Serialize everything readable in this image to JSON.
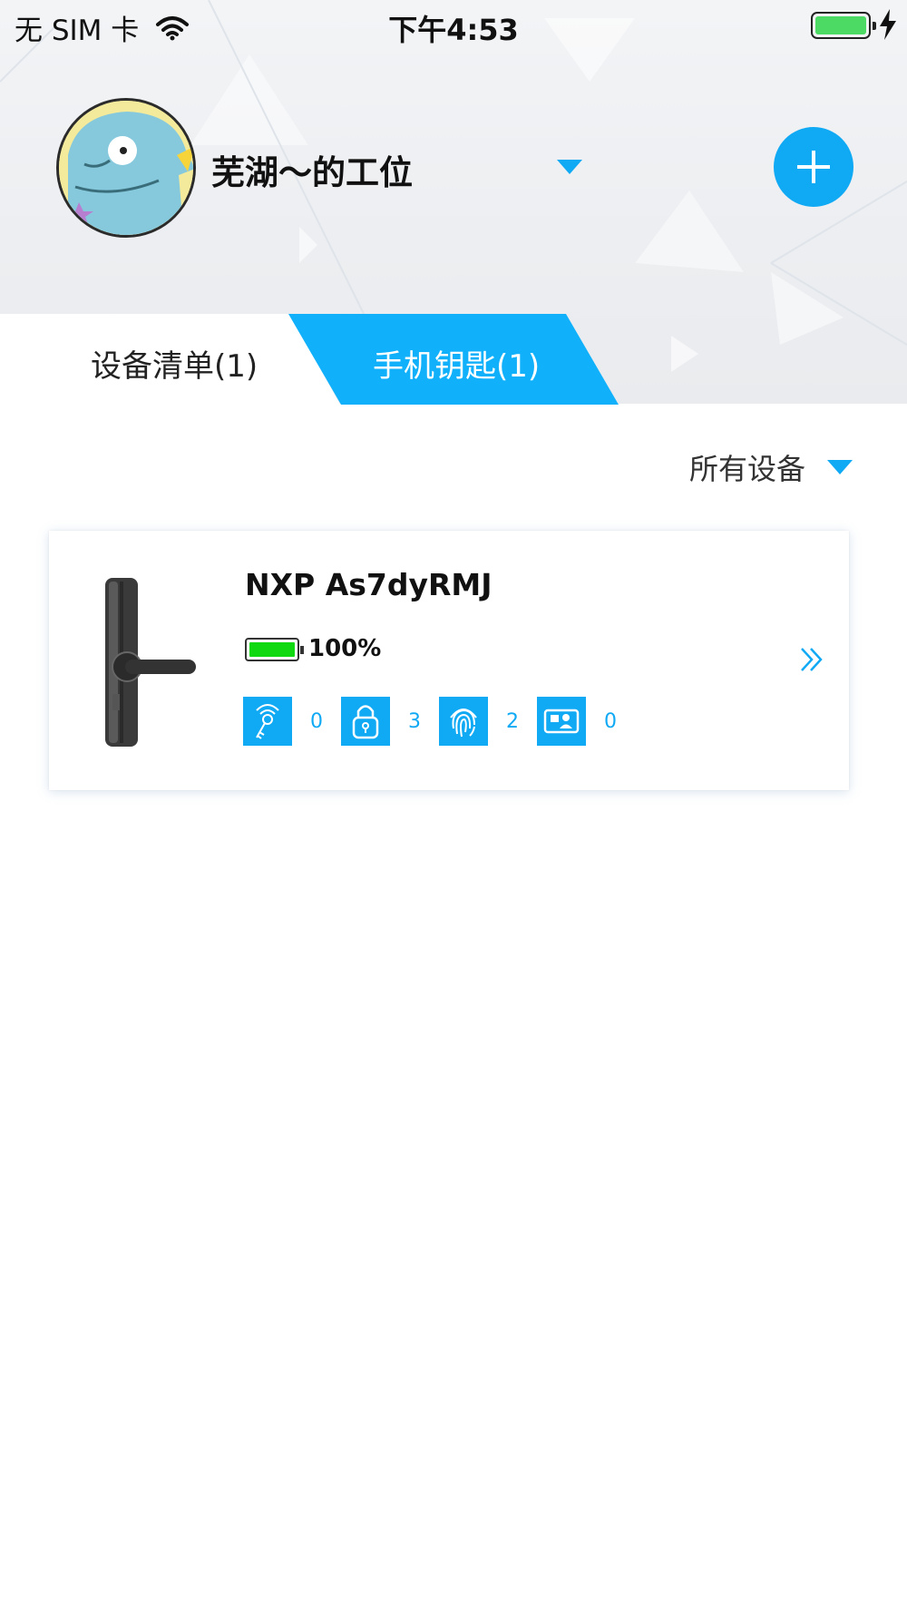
{
  "status_bar": {
    "carrier": "无 SIM 卡",
    "time": "下午4:53",
    "icons": [
      "wifi-icon",
      "battery-icon",
      "charging-icon"
    ]
  },
  "header": {
    "workspace_name": "芜湖～的工位",
    "icons": [
      "avatar",
      "chevron-down-icon",
      "plus-icon"
    ]
  },
  "tabs": [
    {
      "label": "设备清单(1)",
      "active": false
    },
    {
      "label": "手机钥匙(1)",
      "active": true
    }
  ],
  "filter": {
    "label": "所有设备"
  },
  "devices": [
    {
      "name": "NXP As7dyRMJ",
      "battery": "100%",
      "stats": [
        {
          "icon": "key-icon",
          "count": "0"
        },
        {
          "icon": "lock-icon",
          "count": "3"
        },
        {
          "icon": "fingerprint-icon",
          "count": "2"
        },
        {
          "icon": "card-icon",
          "count": "0"
        }
      ]
    }
  ],
  "colors": {
    "accent": "#10a9f4",
    "battery_green": "#11d911"
  }
}
